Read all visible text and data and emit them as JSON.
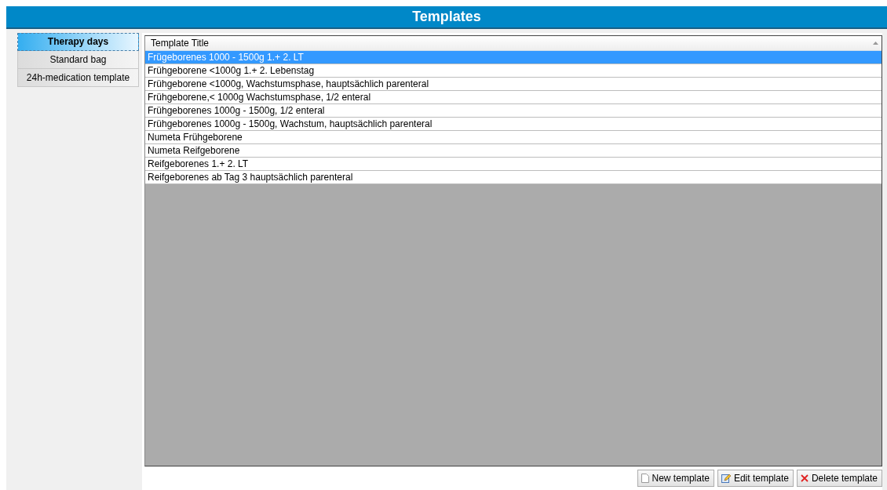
{
  "window": {
    "title": "Templates"
  },
  "tabs": [
    {
      "label": "Therapy days",
      "selected": true
    },
    {
      "label": "Standard bag",
      "selected": false
    },
    {
      "label": "24h-medication template",
      "selected": false
    }
  ],
  "table": {
    "columns": [
      "Template Title"
    ],
    "rows": [
      {
        "title": "Frügeborenes 1000 - 1500g 1.+ 2. LT",
        "selected": true
      },
      {
        "title": "Frühgeborene <1000g 1.+ 2. Lebenstag",
        "selected": false
      },
      {
        "title": "Frühgeborene <1000g, Wachstumsphase, hauptsächlich parenteral",
        "selected": false
      },
      {
        "title": "Frühgeborene,< 1000g Wachstumsphase, 1/2 enteral",
        "selected": false
      },
      {
        "title": "Frühgeborenes 1000g - 1500g, 1/2 enteral",
        "selected": false
      },
      {
        "title": "Frühgeborenes 1000g - 1500g, Wachstum, hauptsächlich parenteral",
        "selected": false
      },
      {
        "title": "Numeta Frühgeborene",
        "selected": false
      },
      {
        "title": "Numeta Reifgeborene",
        "selected": false
      },
      {
        "title": "Reifgeborenes 1.+ 2. LT",
        "selected": false
      },
      {
        "title": "Reifgeborenes ab Tag 3 hauptsächlich parenteral",
        "selected": false
      }
    ]
  },
  "buttons": [
    {
      "kind": "new",
      "label": "New template"
    },
    {
      "kind": "edit",
      "label": "Edit template"
    },
    {
      "kind": "delete",
      "label": "Delete template"
    }
  ]
}
